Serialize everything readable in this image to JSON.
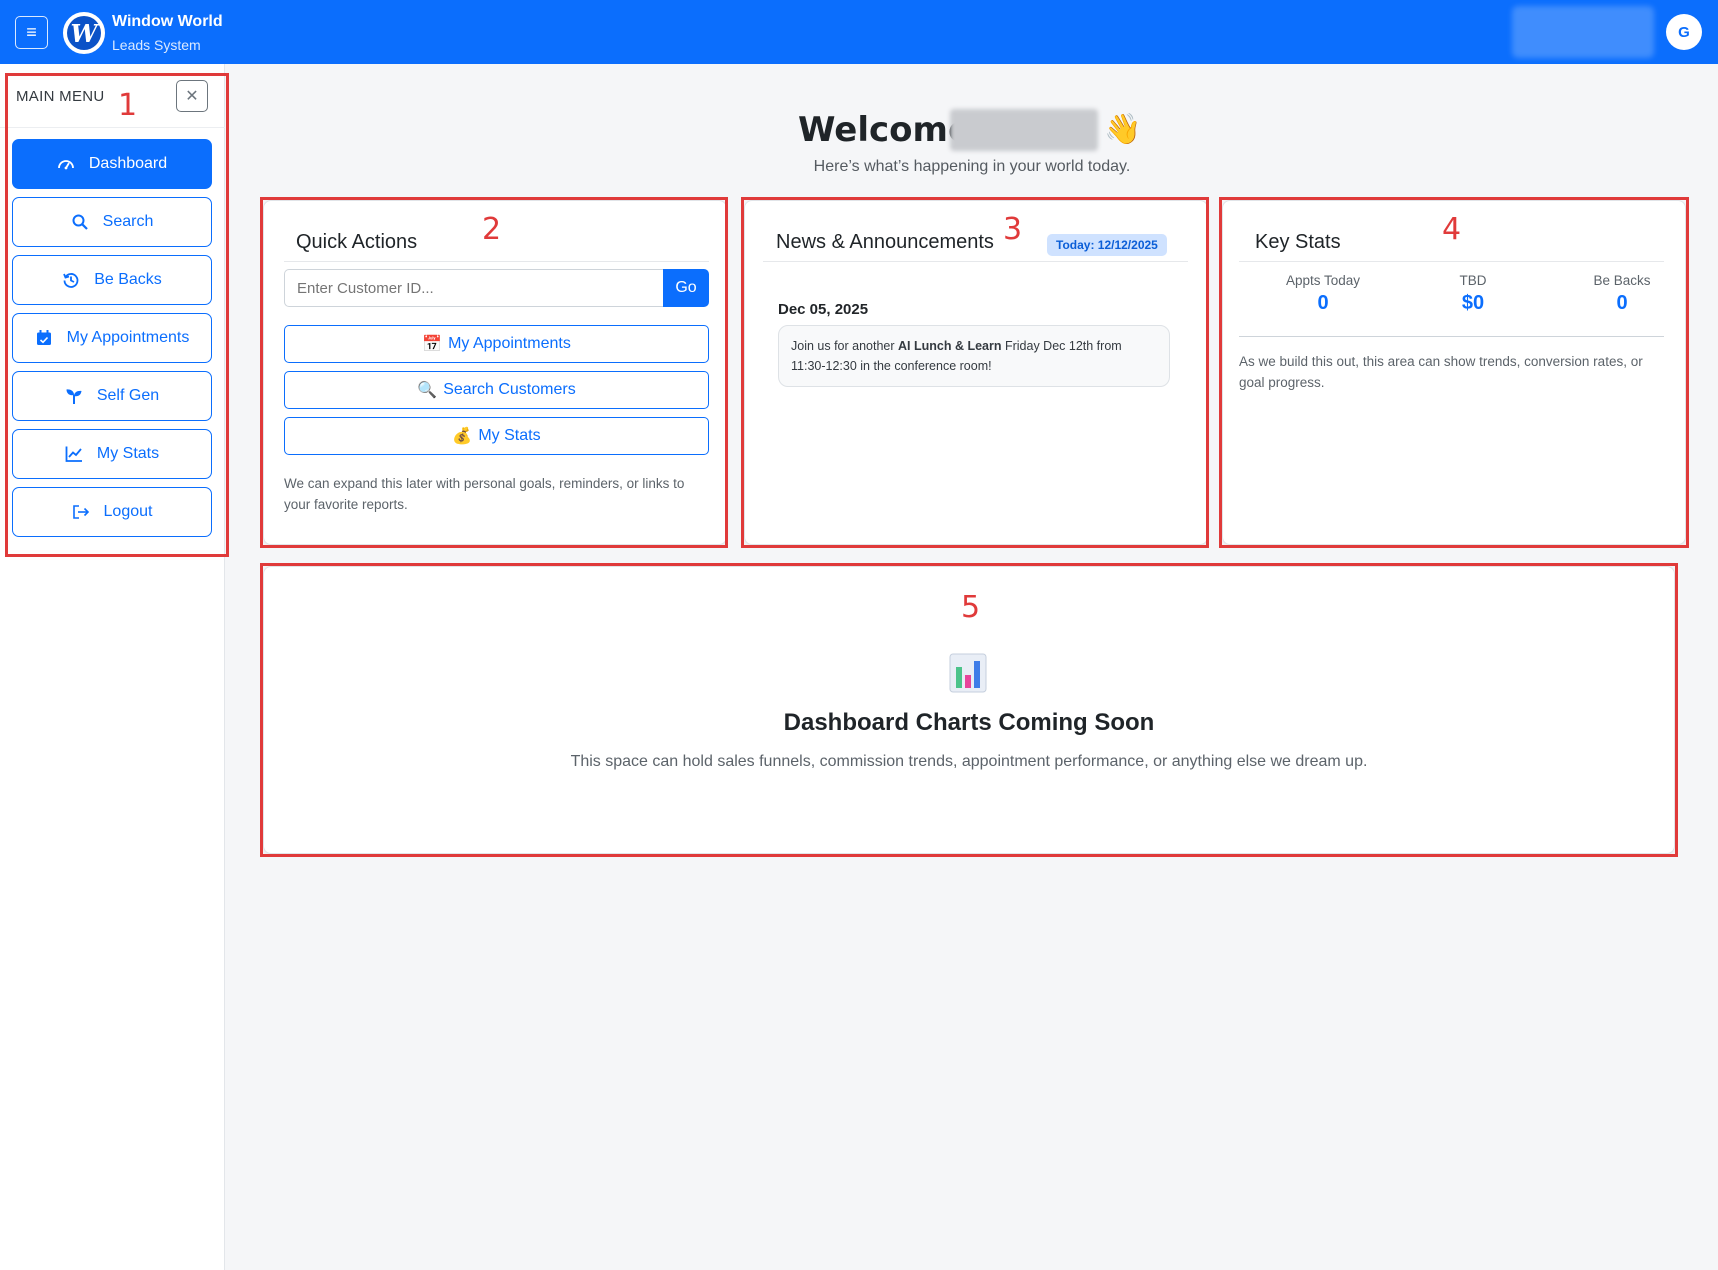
{
  "header": {
    "brand_title": "Window World",
    "brand_subtitle": "Leads System",
    "logo_letter": "W",
    "avatar_letter": "G",
    "accent_color": "#0b6efd"
  },
  "sidebar": {
    "title": "MAIN MENU",
    "items": [
      {
        "label": "Dashboard",
        "icon": "gauge-icon",
        "active": true
      },
      {
        "label": "Search",
        "icon": "search-icon"
      },
      {
        "label": "Be Backs",
        "icon": "history-icon"
      },
      {
        "label": "My Appointments",
        "icon": "calendar-icon"
      },
      {
        "label": "Self Gen",
        "icon": "sprout-icon"
      },
      {
        "label": "My Stats",
        "icon": "line-chart-icon"
      },
      {
        "label": "Logout",
        "icon": "logout-icon"
      }
    ]
  },
  "welcome": {
    "heading": "Welcome,",
    "emoji": "👋",
    "subtitle": "Here’s what’s happening in your world today."
  },
  "quick_actions": {
    "title": "Quick Actions",
    "input_placeholder": "Enter Customer ID...",
    "go_label": "Go",
    "buttons": [
      {
        "emoji": "📅",
        "label": "My Appointments"
      },
      {
        "emoji": "🔍",
        "label": "Search Customers"
      },
      {
        "emoji": "💰",
        "label": "My Stats"
      }
    ],
    "note": "We can expand this later with personal goals, reminders, or links to your favorite reports."
  },
  "news": {
    "title": "News & Announcements",
    "badge": "Today: 12/12/2025",
    "date": "Dec 05, 2025",
    "text_before": "Join us for another ",
    "text_bold": "AI Lunch & Learn",
    "text_after": " Friday Dec 12th from 11:30-12:30 in the conference room!"
  },
  "key_stats": {
    "title": "Key Stats",
    "stats": [
      {
        "label": "Appts Today",
        "value": "0"
      },
      {
        "label": "TBD",
        "value": "$0"
      },
      {
        "label": "Be Backs",
        "value": "0"
      }
    ],
    "note": "As we build this out, this area can show trends, conversion rates, or goal progress."
  },
  "charts_placeholder": {
    "icon": "bar-chart-icon",
    "title": "Dashboard Charts Coming Soon",
    "subtitle": "This space can hold sales funnels, commission trends, appointment performance, or anything else we dream up."
  },
  "annotations": [
    "1",
    "2",
    "3",
    "4",
    "5"
  ]
}
